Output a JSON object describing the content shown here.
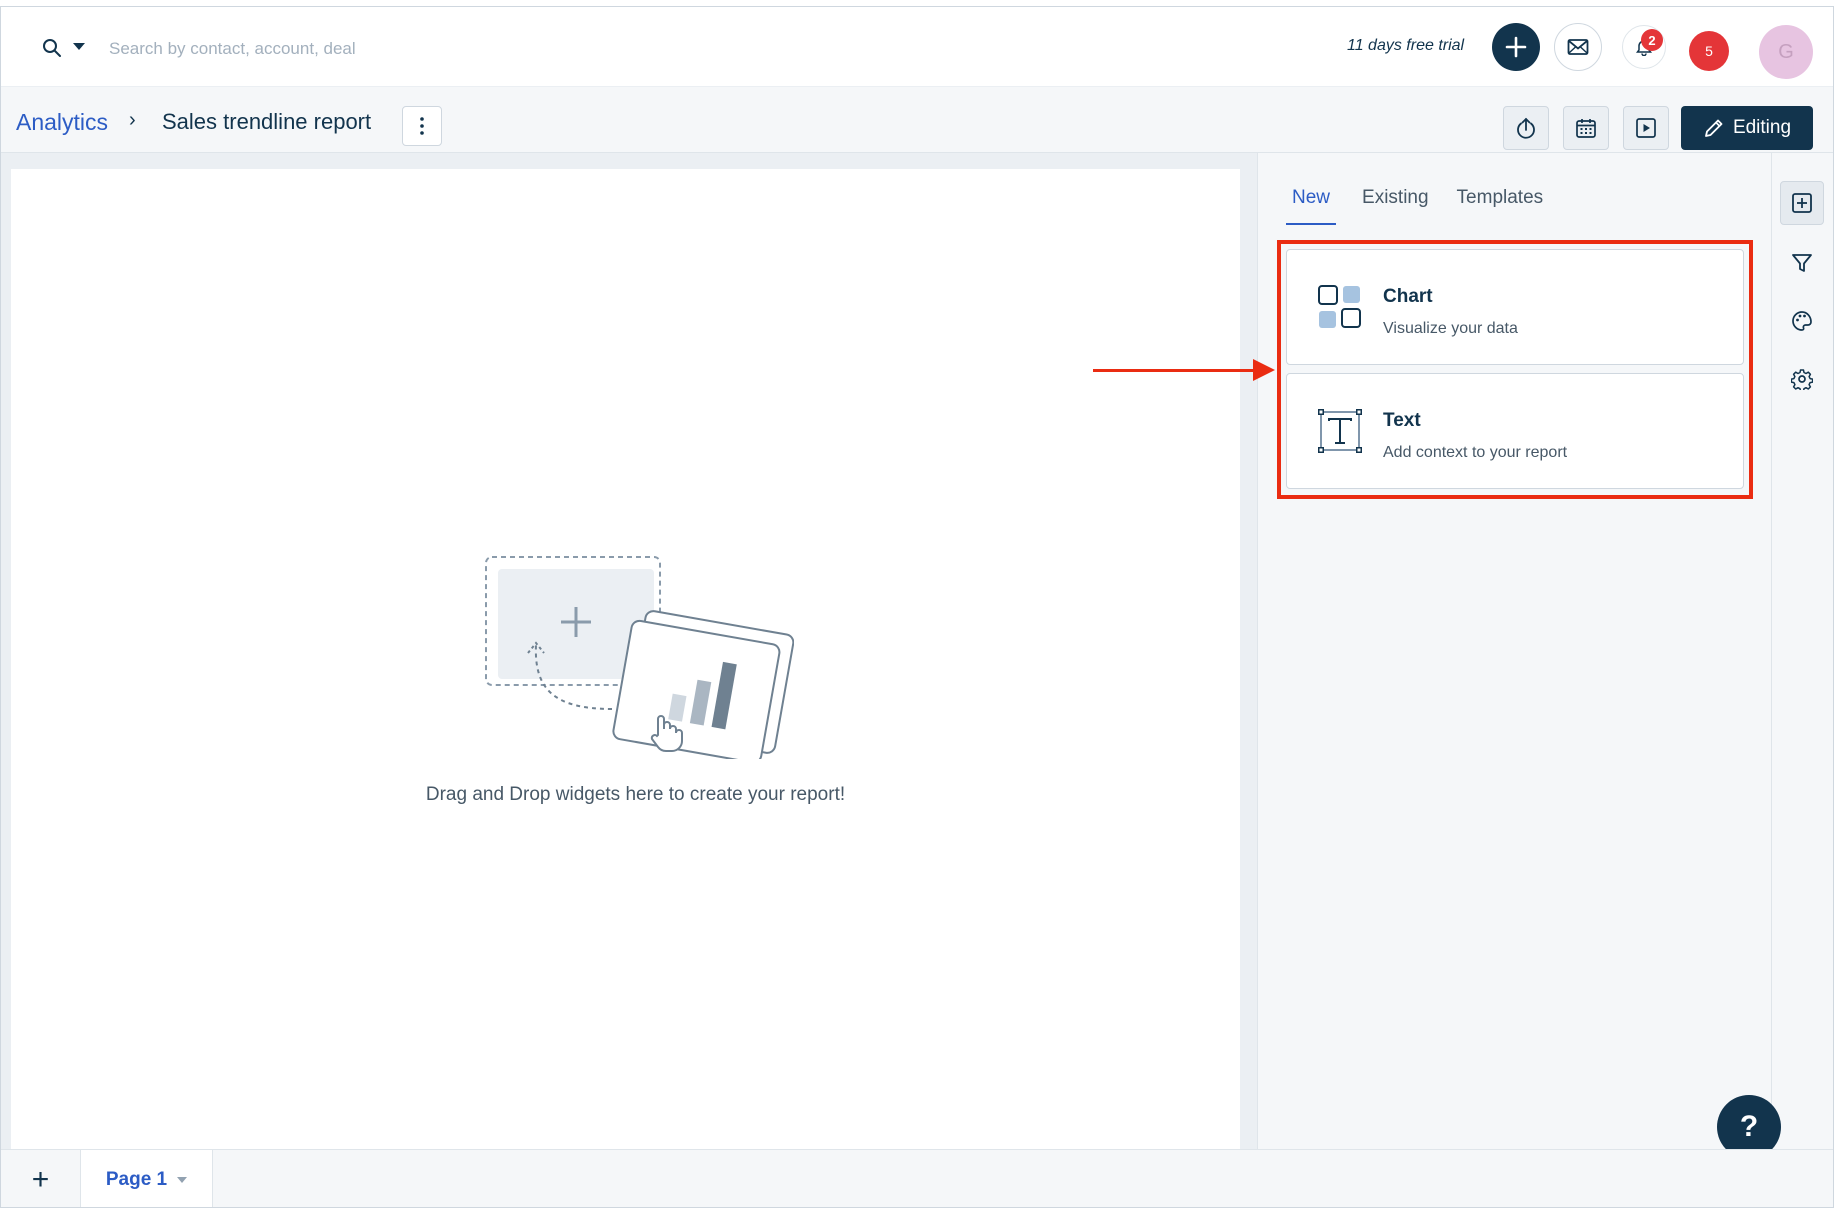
{
  "topbar": {
    "search_placeholder": "Search by contact, account, deal",
    "trial_text": "11 days free trial",
    "notification_count": "2",
    "alert_count": "5",
    "avatar_initial": "G"
  },
  "header": {
    "breadcrumb_root": "Analytics",
    "breadcrumb_separator": "›",
    "report_title": "Sales trendline report",
    "editing_label": "Editing"
  },
  "canvas": {
    "empty_message": "Drag and Drop widgets here to create your report!"
  },
  "panel": {
    "tabs": [
      {
        "label": "New",
        "active": true
      },
      {
        "label": "Existing",
        "active": false
      },
      {
        "label": "Templates",
        "active": false
      }
    ],
    "widgets": [
      {
        "title": "Chart",
        "description": "Visualize your data",
        "icon": "chart-widget-icon"
      },
      {
        "title": "Text",
        "description": "Add context to your report",
        "icon": "text-widget-icon"
      }
    ]
  },
  "help": {
    "label": "?"
  },
  "footer": {
    "add_page_label": "+",
    "page_label": "Page 1"
  },
  "colors": {
    "primary": "#12344d",
    "link": "#2c5cc5",
    "badge": "#e43538",
    "annotation": "#ea2c12"
  }
}
